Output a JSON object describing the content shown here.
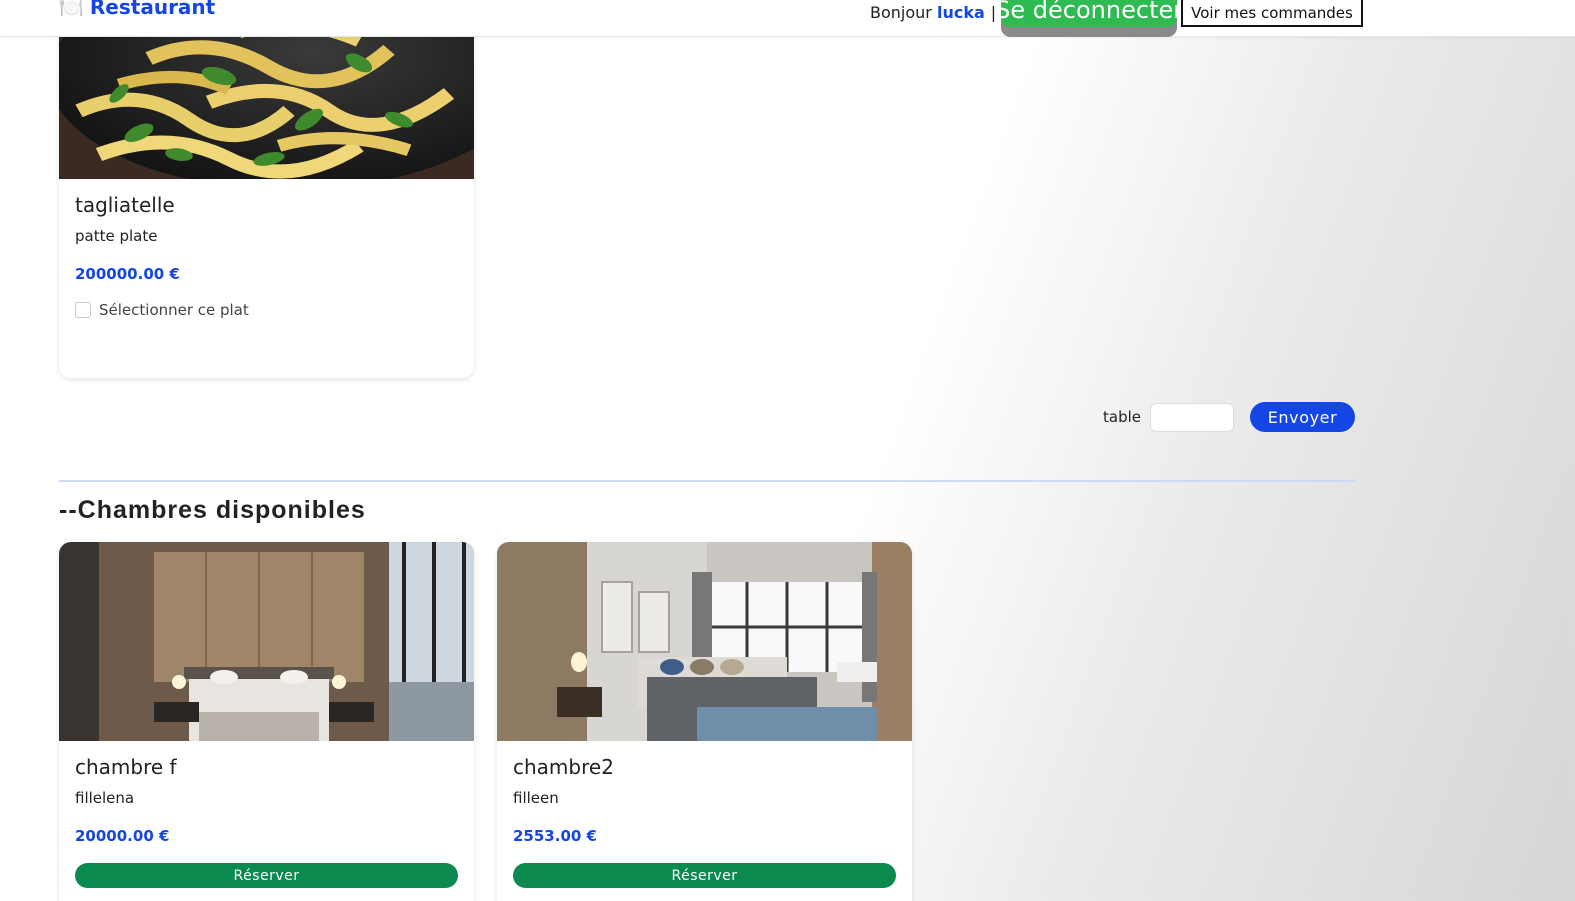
{
  "header": {
    "brand_icon": "🍽️",
    "brand": "Restaurant",
    "greeting": "Bonjour",
    "username": "lucka",
    "separator": "|",
    "logout_label": "Se déconnecter",
    "orders_label": "Voir mes commandes"
  },
  "dishes": [
    {
      "name": "tagliatelle",
      "description": "patte plate",
      "price": "200000.00 €",
      "select_label": "Sélectionner ce plat"
    }
  ],
  "order_form": {
    "table_label": "table",
    "table_value": "",
    "send_label": "Envoyer"
  },
  "rooms_section": {
    "title": "--Chambres disponibles",
    "rooms": [
      {
        "name": "chambre f",
        "description": "fillelena",
        "price": "20000.00 €",
        "reserve_label": "Réserver"
      },
      {
        "name": "chambre2",
        "description": "filleen",
        "price": "2553.00 €",
        "reserve_label": "Réserver"
      }
    ]
  },
  "colors": {
    "accent": "#1446e6",
    "logout": "#2dbb52",
    "reserve": "#0a8a4f"
  }
}
